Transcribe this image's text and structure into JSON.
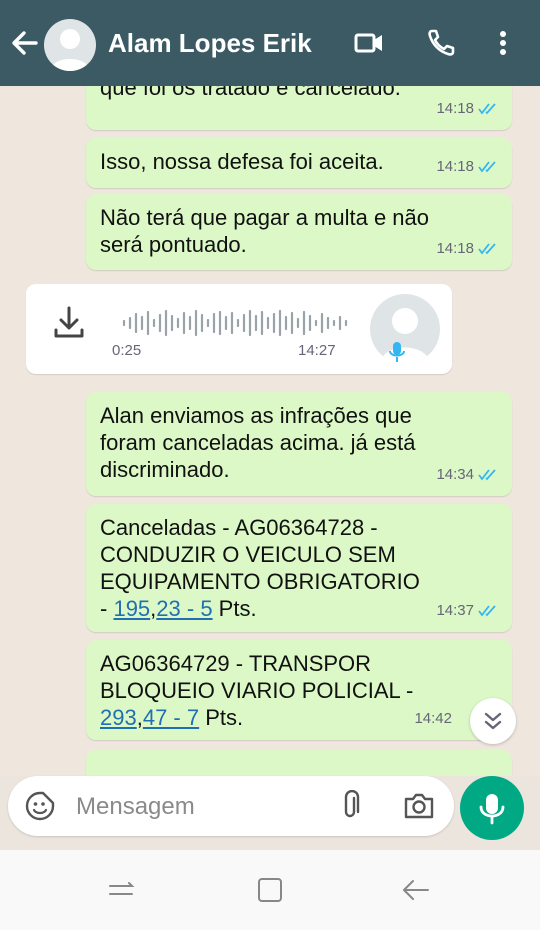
{
  "header": {
    "contact_name": "Alam Lopes Erik"
  },
  "messages": [
    {
      "type": "out",
      "text": "que foi os tratado e cancelado.",
      "time": "14:18"
    },
    {
      "type": "out",
      "text": "Isso, nossa defesa foi aceita.",
      "time": "14:18"
    },
    {
      "type": "out",
      "text": "Não terá que pagar a multa e não será pontuado.",
      "time": "14:18"
    },
    {
      "type": "audio",
      "duration": "0:25",
      "time": "14:27"
    },
    {
      "type": "out",
      "text": "Alan enviamos as infrações que foram canceladas acima. já está discriminado.",
      "time": "14:34"
    },
    {
      "type": "out",
      "text_prefix": "Canceladas - AG06364728 - CONDUZIR O VEICULO SEM EQUIPAMENTO OBRIGATORIO - ",
      "link1": "195",
      "mid": ",",
      "link2": "23 - 5",
      "suffix": " Pts.",
      "time": "14:37"
    },
    {
      "type": "out",
      "text_prefix": "AG06364729 - TRANSPOR BLOQUEIO VIARIO POLICIAL - ",
      "link1": "293",
      "mid": ",",
      "link2": "47 - 7",
      "suffix": " Pts.",
      "time": "14:42"
    }
  ],
  "composer": {
    "placeholder": "Mensagem"
  },
  "colors": {
    "header": "#3b5a64",
    "outgoing": "#dcf8c6",
    "incoming": "#ffffff",
    "accent": "#00a884",
    "read_tick": "#34b7f1"
  },
  "icons": [
    "back-arrow-icon",
    "video-call-icon",
    "phone-icon",
    "more-vert-icon",
    "download-icon",
    "mic-icon",
    "emoji-sticker-icon",
    "attach-icon",
    "camera-icon",
    "scroll-down-icon",
    "nav-recent-icon",
    "nav-home-icon",
    "nav-back-icon"
  ]
}
